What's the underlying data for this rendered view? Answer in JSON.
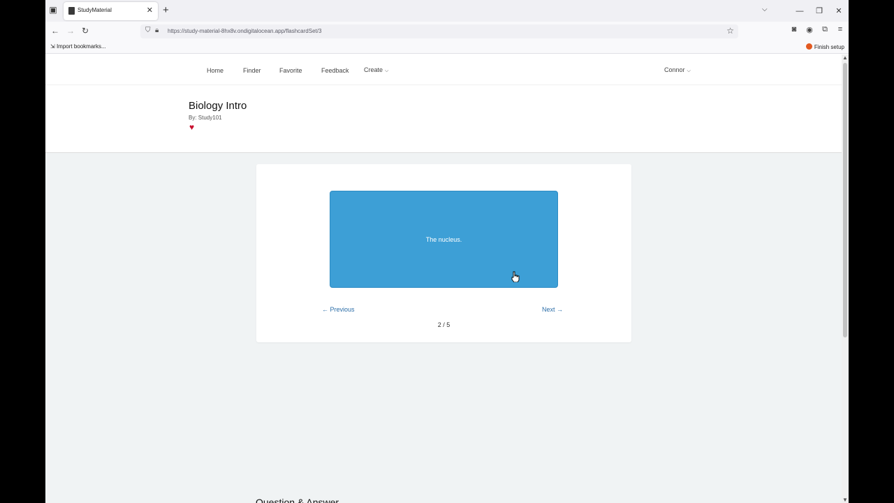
{
  "browser": {
    "tab_title": "StudyMaterial",
    "url": "https://study-material-8hx8v.ondigitalocean.app/flashcardSet/3",
    "bookmarks": {
      "import_label": "Import bookmarks...",
      "finish_setup_label": "Finish setup"
    }
  },
  "site_nav": {
    "home": "Home",
    "finder": "Finder",
    "favorite": "Favorite",
    "feedback": "Feedback",
    "create": "Create",
    "user": "Connor"
  },
  "set": {
    "title": "Biology Intro",
    "author": "By: Study101",
    "favorited": true
  },
  "flashcard": {
    "text": "The nucleus.",
    "prev_label": "← Previous",
    "next_label": "Next →",
    "counter": "2 / 5",
    "current": 2,
    "total": 5
  },
  "section": {
    "qa_heading": "Question & Answer"
  },
  "colors": {
    "card_bg": "#3d9fd6",
    "link": "#2c6ea8",
    "heart": "#c8102e"
  }
}
